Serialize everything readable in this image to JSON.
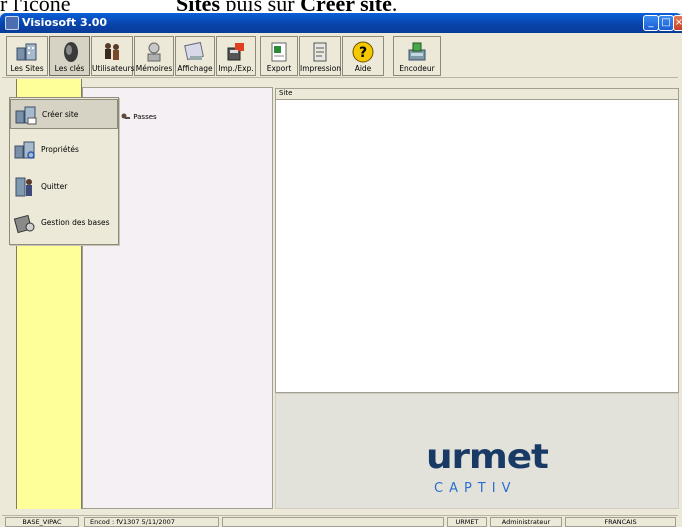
{
  "doc": {
    "left": "r l'icône",
    "bold1": "Sites",
    "mid": " puis sur ",
    "bold2": "Créer site",
    "end": "."
  },
  "window": {
    "title": "Visiosoft 3.00",
    "minimize_icon": "minimize-icon",
    "maximize_icon": "maximize-icon",
    "close_icon": "close-icon"
  },
  "toolbar": {
    "buttons": [
      {
        "label": "Les Sites",
        "icon": "sites-icon"
      },
      {
        "label": "Les clés",
        "icon": "keys-icon"
      },
      {
        "label": "Utilisateurs",
        "icon": "users-icon"
      },
      {
        "label": "Mémoires",
        "icon": "memories-icon"
      },
      {
        "label": "Affichage",
        "icon": "display-icon"
      },
      {
        "label": "Imp./Exp.",
        "icon": "import-export-icon"
      },
      {
        "label": "Export",
        "icon": "export-icon"
      },
      {
        "label": "Impression",
        "icon": "print-icon"
      },
      {
        "label": "Aide",
        "icon": "help-icon"
      },
      {
        "label": "Encodeur",
        "icon": "encoder-icon"
      }
    ]
  },
  "menu": {
    "items": [
      {
        "label": "Créer site",
        "icon": "create-site-icon"
      },
      {
        "label": "Propriétés",
        "icon": "properties-icon"
      },
      {
        "label": "Quitter",
        "icon": "quit-icon"
      },
      {
        "label": "Gestion des bases",
        "icon": "database-management-icon"
      }
    ]
  },
  "tree": {
    "item_label": "Passes",
    "item_icon": "key-icon"
  },
  "site_panel": {
    "header": "Site"
  },
  "logo": {
    "word": "urmet",
    "sub": "CAPTIV"
  },
  "statusbar": {
    "cells": [
      "BASE_VIPAC",
      "Encod : fV1307  5/11/2007",
      "",
      "URMET",
      "Administrateur",
      "FRANCAIS"
    ]
  },
  "colors": {
    "title_bar": "#0842a8",
    "left_strip": "#ffff99",
    "logo_primary": "#1a3a66",
    "logo_secondary": "#2a6fd1"
  }
}
